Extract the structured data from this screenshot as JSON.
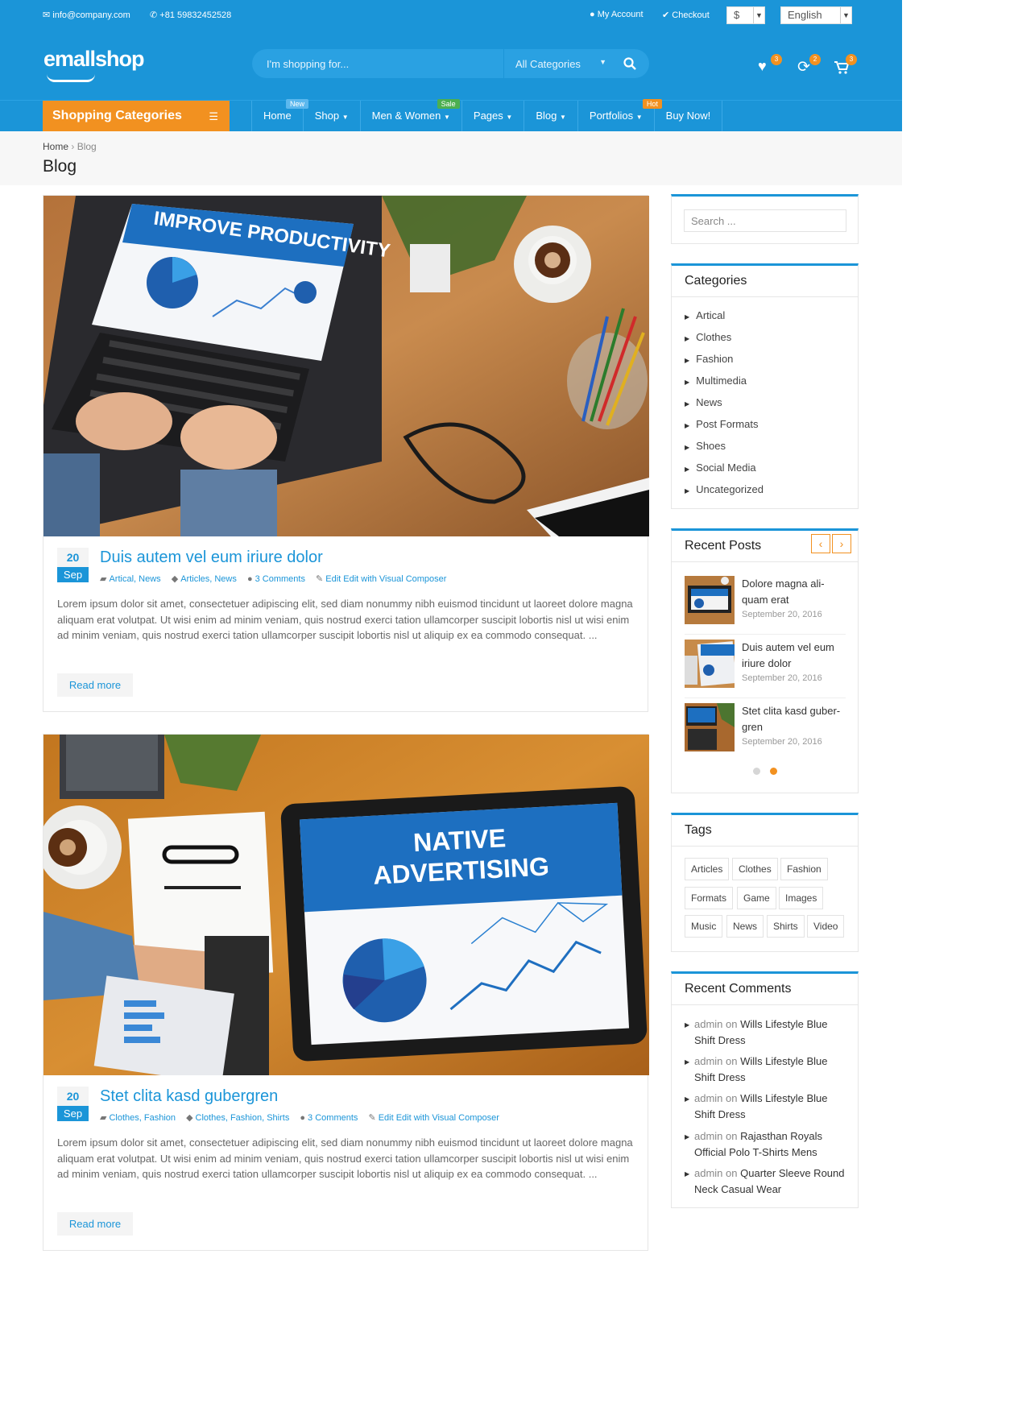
{
  "topbar": {
    "email": "info@company.com",
    "phone": "+81 59832452528",
    "account": "My Account",
    "checkout": "Checkout",
    "currency": "$",
    "language": "English"
  },
  "header": {
    "logo": "emallshop",
    "search_placeholder": "I'm shopping for...",
    "category": "All Categories",
    "wishlist_count": "3",
    "compare_count": "2",
    "cart_count": "3"
  },
  "nav": {
    "shop_categories": "Shopping Categories",
    "items": [
      {
        "label": "Home",
        "tag": "New"
      },
      {
        "label": "Shop"
      },
      {
        "label": "Men & Women",
        "tag": "Sale"
      },
      {
        "label": "Pages"
      },
      {
        "label": "Blog"
      },
      {
        "label": "Portfolios",
        "tag": "Hot"
      },
      {
        "label": "Buy Now!"
      }
    ]
  },
  "breadcrumb": {
    "home": "Home",
    "current": "Blog",
    "title": "Blog"
  },
  "posts": [
    {
      "day": "20",
      "month": "Sep",
      "title": "Duis autem vel eum iriure dolor",
      "categories": "Artical, News",
      "tags": "Articles, News",
      "comments": "3 Comments",
      "edit": "Edit Edit with Visual Composer",
      "excerpt": "Lorem ipsum dolor sit amet, consectetuer adipiscing elit, sed diam nonummy nibh euismod tincidunt ut laoreet dolore magna aliquam erat volutpat. Ut wisi enim ad minim veniam, quis nostrud exerci tation ullamcorper suscipit lobortis nisl ut wisi enim ad minim veniam, quis nostrud exerci tation ullamcorper suscipit lobortis nisl ut aliquip ex ea commodo consequat. ...",
      "read_more": "Read more",
      "image_text": "IMPROVE PRODUCTIVITY"
    },
    {
      "day": "20",
      "month": "Sep",
      "title": "Stet clita kasd gubergren",
      "categories": "Clothes, Fashion",
      "tags": "Clothes, Fashion, Shirts",
      "comments": "3 Comments",
      "edit": "Edit Edit with Visual Composer",
      "excerpt": "Lorem ipsum dolor sit amet, consectetuer adipiscing elit, sed diam nonummy nibh euismod tincidunt ut laoreet dolore magna aliquam erat volutpat. Ut wisi enim ad minim veniam, quis nostrud exerci tation ullamcorper suscipit lobortis nisl ut wisi enim ad minim veniam, quis nostrud exerci tation ullamcorper suscipit lobortis nisl ut aliquip ex ea commodo consequat. ...",
      "read_more": "Read more",
      "image_text_1": "NATIVE",
      "image_text_2": "ADVERTISING"
    }
  ],
  "sidebar": {
    "search_placeholder": "Search ...",
    "categories_title": "Categories",
    "categories": [
      "Artical",
      "Clothes",
      "Fashion",
      "Multimedia",
      "News",
      "Post Formats",
      "Shoes",
      "Social Media",
      "Uncategorized"
    ],
    "recent_posts_title": "Recent Posts",
    "recent_posts": [
      {
        "title": "Dolore magna ali-quam erat",
        "date": "September 20, 2016"
      },
      {
        "title": "Duis autem vel eum iriure dolor",
        "date": "September 20, 2016"
      },
      {
        "title": "Stet clita kasd guber-gren",
        "date": "September 20, 2016"
      }
    ],
    "tags_title": "Tags",
    "tags": [
      "Articles",
      "Clothes",
      "Fashion",
      "Formats",
      "Game",
      "Images",
      "Music",
      "News",
      "Shirts",
      "Video"
    ],
    "recent_comments_title": "Recent Comments",
    "recent_comments": [
      {
        "author": "admin",
        "on": "on",
        "post": "Wills Lifestyle Blue Shift Dress"
      },
      {
        "author": "admin",
        "on": "on",
        "post": "Wills Lifestyle Blue Shift Dress"
      },
      {
        "author": "admin",
        "on": "on",
        "post": "Wills Lifestyle Blue Shift Dress"
      },
      {
        "author": "admin",
        "on": "on",
        "post": "Rajasthan Royals Official Polo T-Shirts Mens"
      },
      {
        "author": "admin",
        "on": "on",
        "post": "Quarter Sleeve Round Neck Casual Wear"
      }
    ]
  },
  "colors": {
    "primary": "#1b95d8",
    "accent": "#f29120"
  }
}
